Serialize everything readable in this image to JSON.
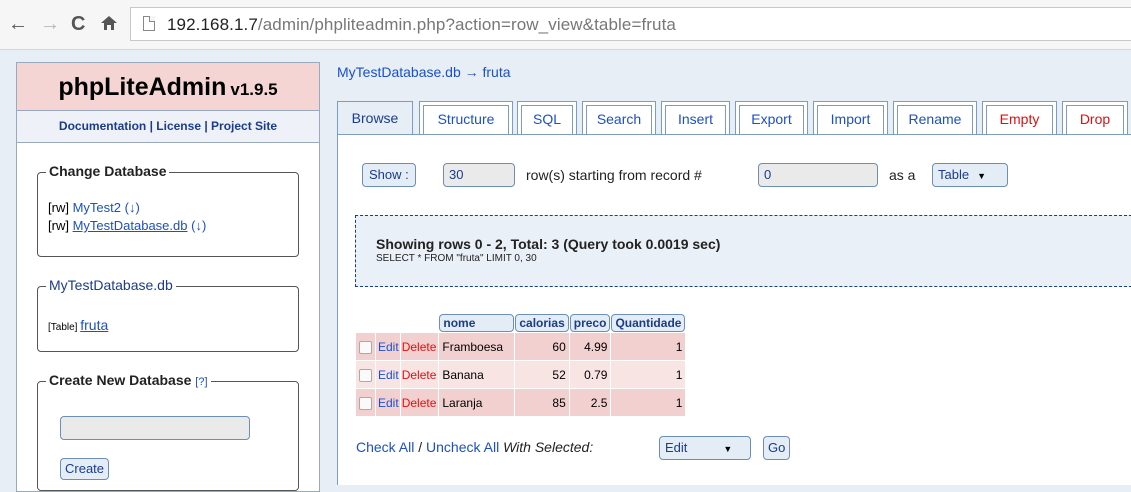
{
  "browser": {
    "url_host": "192.168.1.7",
    "url_path": "/admin/phpliteadmin.php?action=row_view&table=fruta"
  },
  "sidebar": {
    "app_name": "phpLiteAdmin",
    "version": "v1.9.5",
    "links": [
      "Documentation",
      "License",
      "Project Site"
    ],
    "link_separator": " | ",
    "change_db_legend": "Change Database",
    "databases": [
      {
        "mode": "[rw]",
        "name": "MyTest2",
        "arrow": "(↓)"
      },
      {
        "mode": "[rw]",
        "name": "MyTestDatabase.db",
        "arrow": "(↓)"
      }
    ],
    "current_db_legend": "MyTestDatabase.db",
    "table_prefix": "[Table]",
    "table_name": "fruta",
    "create_db_legend": "Create New Database",
    "help_link": "[?]",
    "create_input_value": "",
    "create_button": "Create"
  },
  "main": {
    "breadcrumb": "MyTestDatabase.db → fruta",
    "tabs": [
      {
        "label": "Browse",
        "active": true
      },
      {
        "label": "Structure"
      },
      {
        "label": "SQL"
      },
      {
        "label": "Search"
      },
      {
        "label": "Insert"
      },
      {
        "label": "Export"
      },
      {
        "label": "Import"
      },
      {
        "label": "Rename"
      },
      {
        "label": "Empty",
        "danger": true
      },
      {
        "label": "Drop",
        "danger": true
      }
    ],
    "show_button": "Show :",
    "rows_value": "30",
    "rows_text": "row(s) starting from record #",
    "start_value": "0",
    "as_a_text": "as a",
    "view_select": "Table",
    "query_title": "Showing rows 0 - 2, Total: 3 (Query took 0.0019 sec)",
    "query_sql": "SELECT * FROM \"fruta\" LIMIT 0, 30",
    "columns": [
      "nome",
      "calorias",
      "preco",
      "Quantidade"
    ],
    "row_actions": {
      "edit": "Edit",
      "delete": "Delete"
    },
    "rows": [
      [
        "Framboesa",
        "60",
        "4.99",
        "1"
      ],
      [
        "Banana",
        "52",
        "0.79",
        "1"
      ],
      [
        "Laranja",
        "85",
        "2.5",
        "1"
      ]
    ],
    "check_all": "Check All",
    "slash": " / ",
    "uncheck_all": "Uncheck All",
    "with_selected": "With Selected:",
    "bulk_action": "Edit",
    "go_button": "Go"
  }
}
